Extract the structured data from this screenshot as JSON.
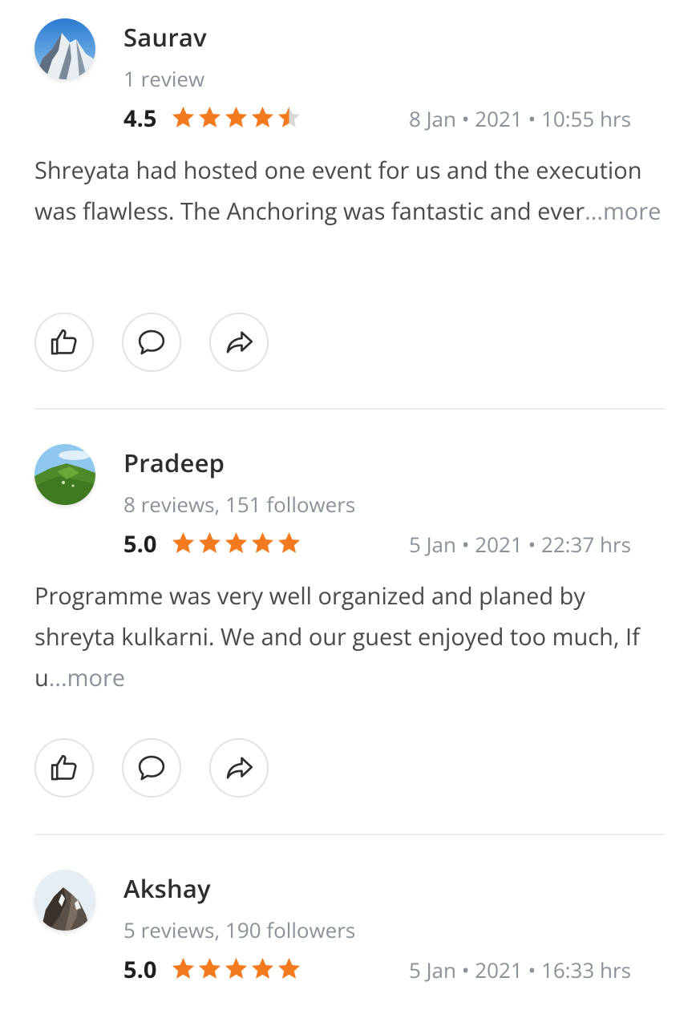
{
  "reviews": [
    {
      "name": "Saurav",
      "meta": "1 review",
      "rating": "4.5",
      "stars": 4.5,
      "date": "8 Jan • 2021 • 10:55 hrs",
      "text": "Shreyata had hosted one event for us and the execution was flawless. The Anchoring was fantastic and ever",
      "more": "...more"
    },
    {
      "name": "Pradeep",
      "meta": "8 reviews, 151 followers",
      "rating": "5.0",
      "stars": 5,
      "date": "5 Jan • 2021 • 22:37 hrs",
      "text": "Programme was very well organized and planed by shreyta kulkarni. We and our guest enjoyed too much, If u",
      "more": "...more"
    },
    {
      "name": "Akshay",
      "meta": "5 reviews, 190 followers",
      "rating": "5.0",
      "stars": 5,
      "date": "5 Jan • 2021 • 16:33 hrs"
    }
  ],
  "colors": {
    "star": "#f47a1f",
    "star_empty": "#d8d8d8"
  },
  "icons": [
    "thumbs-up-icon",
    "comment-icon",
    "share-icon"
  ]
}
